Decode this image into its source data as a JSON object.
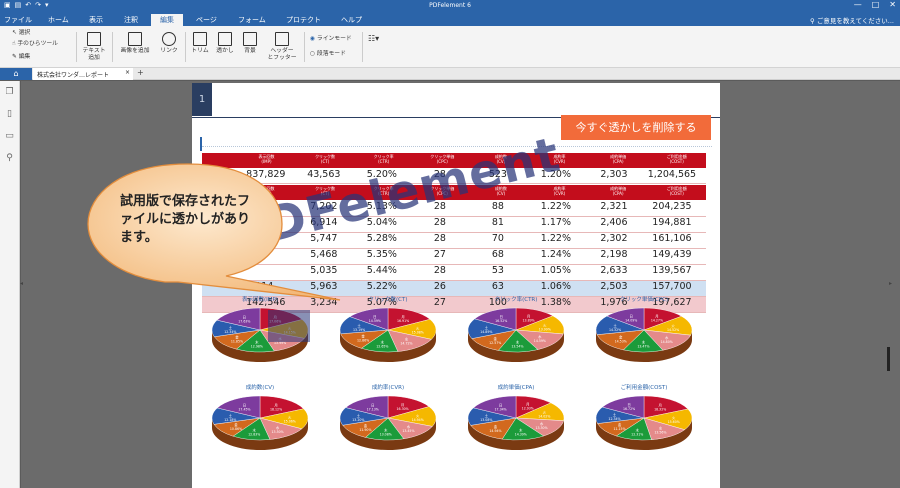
{
  "app": {
    "title": "PDFelement 6"
  },
  "menu": [
    "ファイル",
    "ホーム",
    "表示",
    "注釈",
    "編集",
    "ページ",
    "フォーム",
    "プロテクト",
    "ヘルプ"
  ],
  "menu_active": "編集",
  "feedback": "ご意見を教えてください...",
  "ribbon": {
    "select": "選択",
    "hand": "手のひらツール",
    "edit": "編集",
    "add_text": "テキスト\n追加",
    "add_image": "画像を追加",
    "link": "リンク",
    "crop": "トリム",
    "watermark": "透かし",
    "background": "背景",
    "header_footer": "ヘッダー\nとフッター",
    "line_mode": "ラインモード",
    "para_mode": "段落モード"
  },
  "tab": {
    "doc_name": "株式会社ワンダ…レポート",
    "close": "×",
    "home_icon": "home-icon"
  },
  "page_num": "1",
  "remove_watermark": "今すぐ透かしを削除する",
  "bubble_text": "試用版で保存されたファイルに透かしがあります。",
  "watermark": "PDFelement",
  "table": {
    "header1": [
      "",
      "表示回数\n(IMP)",
      "クリック数\n(CT)",
      "クリック率\n(CTR)",
      "クリック単価\n(CPC)",
      "成約数\n(CV)",
      "成約率\n(CVR)",
      "成約単価\n(CPA)",
      "ご利用金額\n(COST)"
    ],
    "summary": [
      "",
      "837,829",
      "43,563",
      "5.20%",
      "28",
      "523",
      "1.20%",
      "2,303",
      "1,204,565"
    ],
    "header2": [
      "",
      "表示回数\n(IMP)",
      "クリック数\n(CT)",
      "クリック率\n(CTR)",
      "クリック単価\n(CPC)",
      "成約数\n(CV)",
      "成約率\n(CVR)",
      "成約単価\n(CPA)",
      "ご利用金額\n(COST)"
    ],
    "rows": [
      [
        "",
        "409",
        "7,202",
        "5.13%",
        "28",
        "88",
        "1.22%",
        "2,321",
        "204,235"
      ],
      [
        "",
        "75",
        "6,914",
        "5.04%",
        "28",
        "81",
        "1.17%",
        "2,406",
        "194,881"
      ],
      [
        "",
        "02",
        "5,747",
        "5.28%",
        "28",
        "70",
        "1.22%",
        "2,302",
        "161,106"
      ],
      [
        "",
        "",
        "5,468",
        "5.35%",
        "27",
        "68",
        "1.24%",
        "2,198",
        "149,439"
      ],
      [
        "",
        "",
        "5,035",
        "5.44%",
        "28",
        "53",
        "1.05%",
        "2,633",
        "139,567"
      ],
      [
        "",
        "114,",
        "5,963",
        "5.22%",
        "26",
        "63",
        "1.06%",
        "2,503",
        "157,700"
      ],
      [
        "",
        "142,546",
        "3,234",
        "5.07%",
        "27",
        "100",
        "1.38%",
        "1,976",
        "197,627"
      ]
    ]
  },
  "charts": [
    {
      "title": "表示回数(IMP)"
    },
    {
      "title": "クリック数(CT)"
    },
    {
      "title": "クリック率(CTR)"
    },
    {
      "title": "クリック単価(CPC)"
    },
    {
      "title": "成約数(CV)"
    },
    {
      "title": "成約率(CVR)"
    },
    {
      "title": "成約単価(CPA)"
    },
    {
      "title": "ご利用金額(COST)"
    }
  ],
  "pie_colors": [
    "#c41230",
    "#f5b800",
    "#e48a8a",
    "#1b9b3a",
    "#d2691e",
    "#2a5cae",
    "#7d3b9e"
  ],
  "pie_labels": [
    "月",
    "火",
    "水",
    "木",
    "金",
    "土",
    "日"
  ],
  "pie_values": [
    [
      17.06,
      14.15,
      13.99,
      12.98,
      11.85,
      12.34,
      17.63
    ],
    [
      16.91,
      15.08,
      14.72,
      12.65,
      12.86,
      13.19,
      14.59
    ],
    [
      13.89,
      13.99,
      14.59,
      13.54,
      12.57,
      14.89,
      16.52
    ],
    [
      14.27,
      14.52,
      14.8,
      13.47,
      14.53,
      14.32,
      14.09
    ],
    [
      18.12,
      15.06,
      13.5,
      12.83,
      10.86,
      12.18,
      17.45
    ],
    [
      16.3,
      14.94,
      13.45,
      13.08,
      11.9,
      13.2,
      17.13
    ],
    [
      12.93,
      14.02,
      13.3,
      14.39,
      14.94,
      13.08,
      17.34
    ],
    [
      18.32,
      15.6,
      13.56,
      12.31,
      11.15,
      12.34,
      16.72
    ]
  ],
  "ribbon_icons": [
    "cursor-icon",
    "hand-icon",
    "edit-icon",
    "text-box-icon",
    "image-icon",
    "link-icon",
    "crop-icon",
    "watermark-icon",
    "background-icon",
    "header-footer-icon"
  ]
}
